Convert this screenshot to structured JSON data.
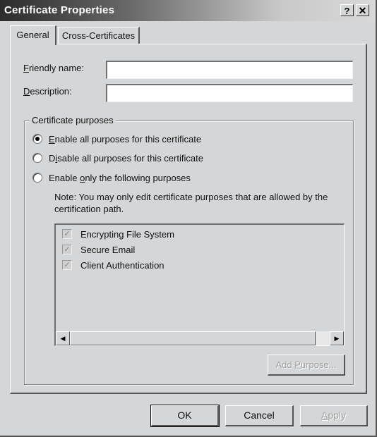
{
  "window": {
    "title": "Certificate Properties",
    "help_button": "?",
    "close_button": "✕"
  },
  "tabs": [
    {
      "label": "General",
      "active": true
    },
    {
      "label": "Cross-Certificates",
      "active": false
    }
  ],
  "fields": {
    "friendly_name": {
      "label_mnemonic": "F",
      "label_rest": "riendly name:",
      "value": ""
    },
    "description": {
      "label_mnemonic": "D",
      "label_rest": "escription:",
      "value": ""
    }
  },
  "purposes_group": {
    "legend": "Certificate purposes",
    "options": [
      {
        "pre": "",
        "mnemonic": "E",
        "post": "nable all purposes for this certificate",
        "selected": true
      },
      {
        "pre": "D",
        "mnemonic": "i",
        "post": "sable all purposes for this certificate",
        "selected": false
      },
      {
        "pre": "Enable ",
        "mnemonic": "o",
        "post": "nly the following purposes",
        "selected": false
      }
    ],
    "note": "Note: You may only edit certificate purposes that are allowed by the certification path.",
    "purposes": [
      {
        "label": "Encrypting File System",
        "checked": true,
        "enabled": false
      },
      {
        "label": "Secure Email",
        "checked": true,
        "enabled": false
      },
      {
        "label": "Client Authentication",
        "checked": true,
        "enabled": false
      }
    ],
    "scroll_left_icon": "◀",
    "scroll_right_icon": "▶",
    "add_purpose": {
      "pre": "Add ",
      "mnemonic": "P",
      "post": "urpose...",
      "enabled": false
    }
  },
  "buttons": {
    "ok": "OK",
    "cancel": "Cancel",
    "apply": {
      "mnemonic": "A",
      "post": "pply",
      "enabled": false
    }
  }
}
